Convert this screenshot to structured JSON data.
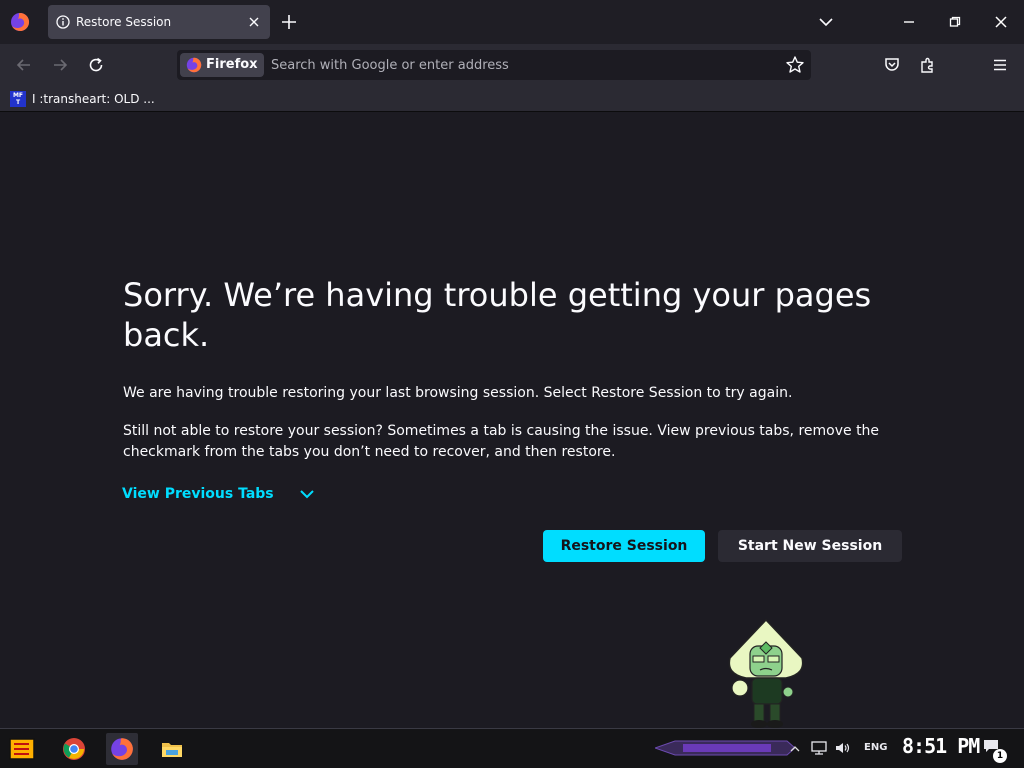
{
  "browser": {
    "tab": {
      "title": "Restore Session"
    },
    "identity_label": "Firefox",
    "url_placeholder": "Search with Google or enter address",
    "bookmarks": [
      {
        "favicon_text": "MF T",
        "label": "I :transheart: OLD ..."
      }
    ]
  },
  "page": {
    "title": "Sorry. We’re having trouble getting your pages back.",
    "paragraph1": "We are having trouble restoring your last browsing session. Select Restore Session to try again.",
    "paragraph2": "Still not able to restore your session? Sometimes a tab is causing the issue. View previous tabs, remove the checkmark from the tabs you don’t need to recover, and then restore.",
    "view_previous_tabs": "View Previous Tabs",
    "restore_button": "Restore Session",
    "new_session_button": "Start New Session"
  },
  "taskbar": {
    "language": "ENG",
    "time": "8:51 PM",
    "notification_count": "1"
  },
  "colors": {
    "accent": "#00ddff",
    "background": "#1c1b22",
    "toolbar": "#2b2a33"
  },
  "icons": {
    "tabstrip": [
      "firefox-icon",
      "info-icon",
      "close-icon",
      "plus-icon",
      "chevron-down-icon",
      "minimize-icon",
      "maximize-icon",
      "close-window-icon"
    ],
    "toolbar": [
      "back-arrow-icon",
      "forward-arrow-icon",
      "reload-icon",
      "star-icon",
      "pocket-icon",
      "extensions-icon",
      "menu-icon"
    ],
    "taskbar": [
      "start-icon",
      "chrome-icon",
      "firefox-icon",
      "file-explorer-icon",
      "network-icon",
      "volume-icon",
      "notification-icon"
    ]
  }
}
